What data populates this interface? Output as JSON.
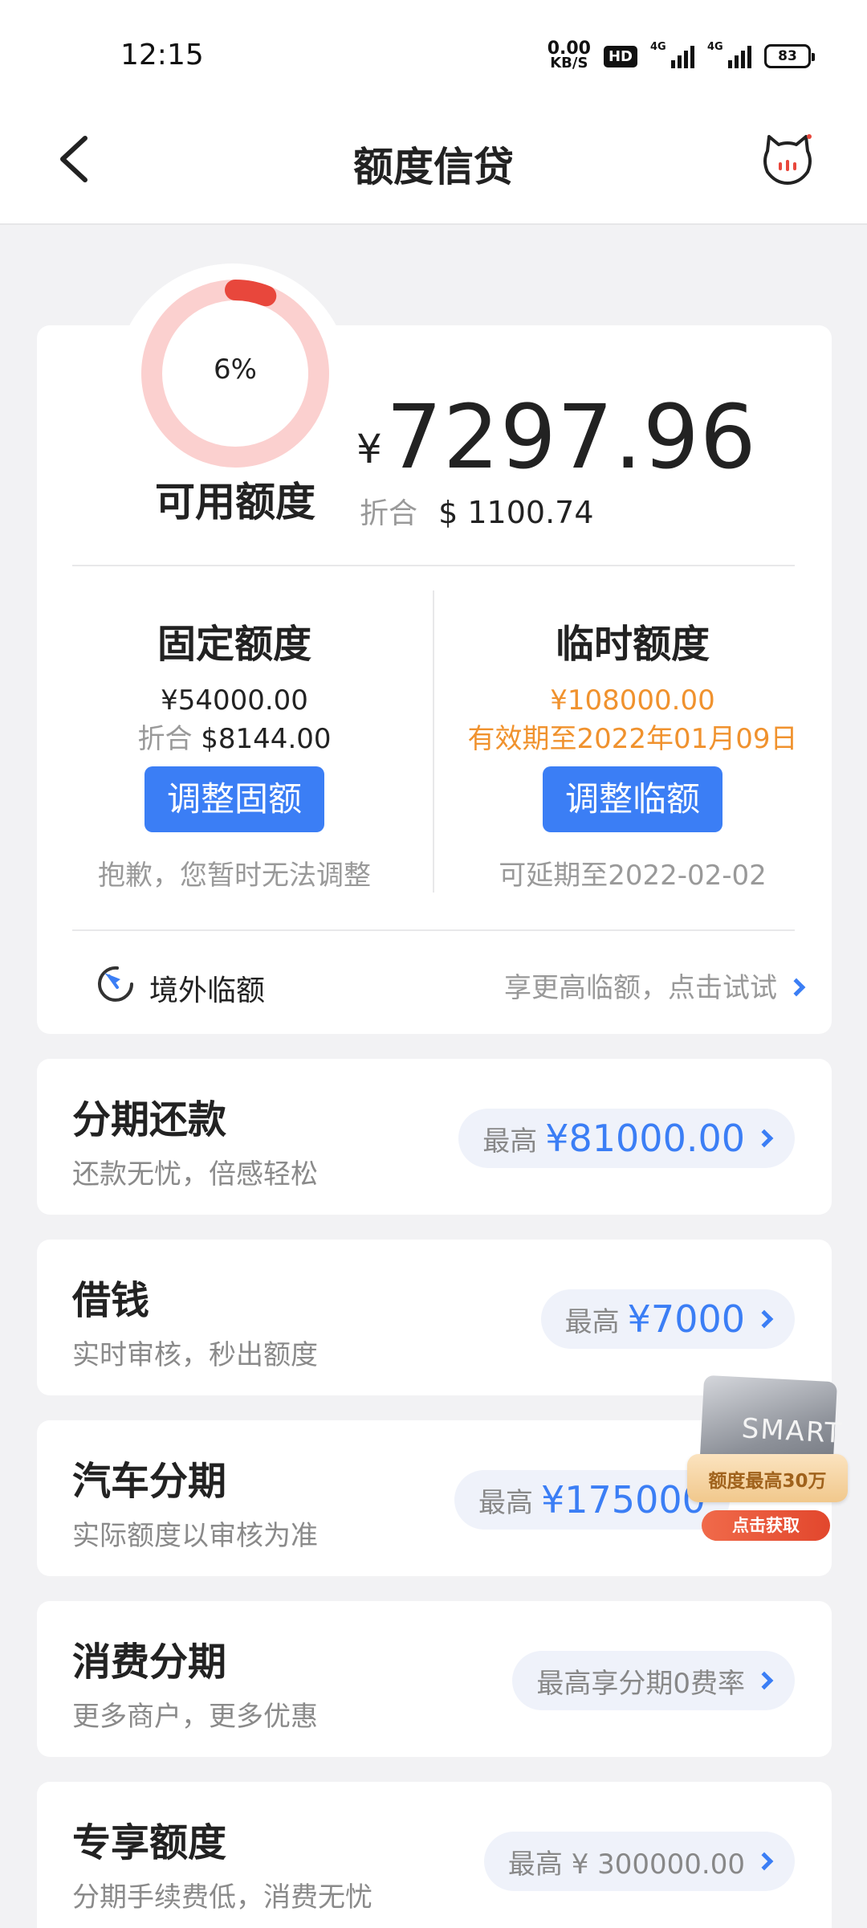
{
  "status_bar": {
    "time": "12:15",
    "speed_value": "0.00",
    "speed_unit": "KB/S",
    "hd_label": "HD",
    "net1": "4G",
    "net2": "4G",
    "battery": "83"
  },
  "header": {
    "title": "额度信贷",
    "back_icon": "chevron-left-icon",
    "mascot_icon": "cat-mascot-icon"
  },
  "credit": {
    "used_percent_label": "6%",
    "used_fraction": 0.06,
    "available_label": "可用额度",
    "currency_symbol": "¥",
    "available_amount": "7297.96",
    "converted_label": "折合",
    "converted_amount": "$ 1100.74",
    "colors": {
      "ring_track": "#fbd0cf",
      "ring_fill": "#e8473c",
      "accent": "#3b7ef5",
      "orange": "#f0922e"
    }
  },
  "fixed": {
    "title": "固定额度",
    "amount": "¥54000.00",
    "converted_label": "折合",
    "converted_amount": "$8144.00",
    "button": "调整固额",
    "note": "抱歉，您暂时无法调整"
  },
  "temp": {
    "title": "临时额度",
    "amount": "¥108000.00",
    "validity": "有效期至2022年01月09日",
    "button": "调整临额",
    "note": "可延期至2022-02-02"
  },
  "overseas": {
    "icon": "plane-clock-icon",
    "label": "境外临额",
    "link": "享更高临额，点击试试"
  },
  "products": [
    {
      "title": "分期还款",
      "subtitle": "还款无忧，倍感轻松",
      "prefix": "最高",
      "value": "¥81000.00"
    },
    {
      "title": "借钱",
      "subtitle": "实时审核，秒出额度",
      "prefix": "最高",
      "value": "¥7000"
    },
    {
      "title": "汽车分期",
      "subtitle": "实际额度以审核为准",
      "prefix": "最高",
      "value": "¥175000"
    },
    {
      "title": "消费分期",
      "subtitle": "更多商户，更多优惠",
      "prefix": "",
      "value": "最高享分期0费率"
    },
    {
      "title": "专享额度",
      "subtitle": "分期手续费低，消费无忧",
      "prefix": "",
      "value": "最高 ¥ 300000.00"
    }
  ],
  "promo": {
    "card_text": "SMART",
    "headline": "额度最高30万",
    "button": "点击获取"
  }
}
